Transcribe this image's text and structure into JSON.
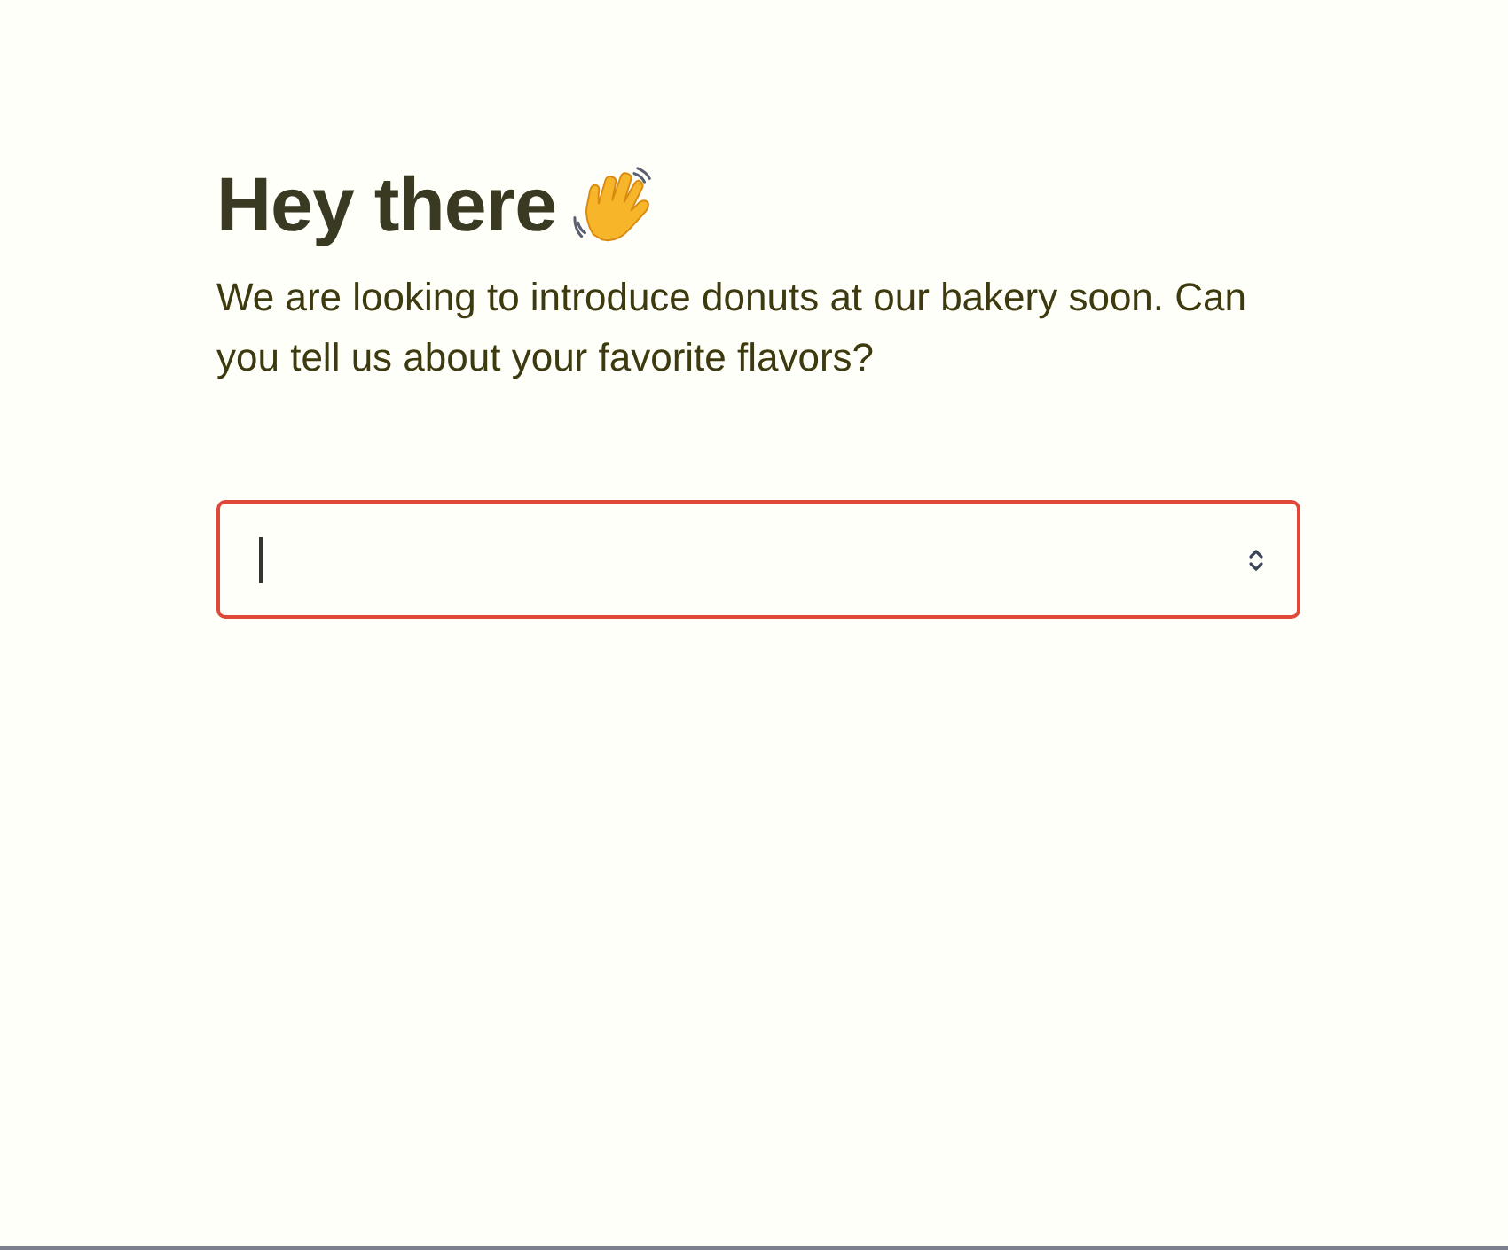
{
  "heading": "Hey there",
  "intro": "We are looking to introduce donuts at our bakery soon. Can you tell us about your favorite flavors?",
  "combobox": {
    "focused": true
  }
}
